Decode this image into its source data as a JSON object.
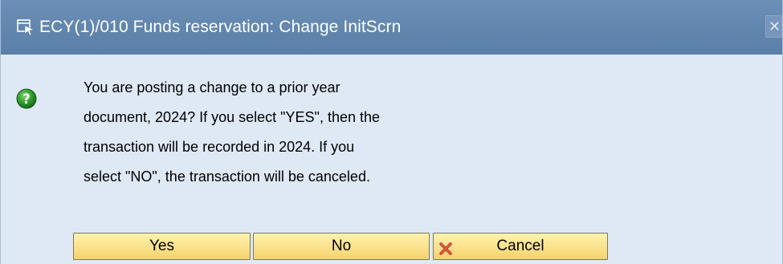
{
  "dialog": {
    "title": "ECY(1)/010 Funds reservation: Change InitScrn",
    "message_lines": [
      "You are posting a change to a prior year",
      "document, 2024? If you select \"YES\", then the",
      "transaction will be recorded in 2024. If you",
      "select \"NO\", the transaction will be canceled."
    ],
    "buttons": {
      "yes_label": "Yes",
      "no_label": "No",
      "cancel_label": "Cancel"
    },
    "icons": {
      "title_icon": "window-menu-icon",
      "message_icon": "question-icon",
      "close_icon": "close-icon",
      "cancel_icon": "cancel-x-icon"
    },
    "colors": {
      "titlebar": "#5f84ad",
      "background": "#dfe9f5",
      "button": "#fbe18a",
      "question_icon": "#2e8b2e",
      "cancel_x": "#c0392b"
    }
  }
}
